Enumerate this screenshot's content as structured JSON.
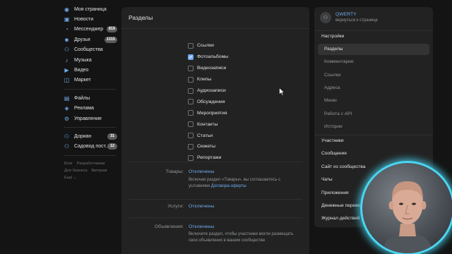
{
  "left_nav": {
    "items": [
      {
        "label": "Моя страница",
        "icon": "user-circle-icon",
        "glyph": "◉"
      },
      {
        "label": "Новости",
        "icon": "news-icon",
        "glyph": "▣"
      },
      {
        "label": "Мессенджер",
        "icon": "messenger-icon",
        "glyph": "◔",
        "badge": "819"
      },
      {
        "label": "Друзья",
        "icon": "friends-icon",
        "glyph": "☻",
        "badge": "1315"
      },
      {
        "label": "Сообщества",
        "icon": "communities-icon",
        "glyph": "⚇"
      },
      {
        "label": "Музыка",
        "icon": "music-icon",
        "glyph": "♪"
      },
      {
        "label": "Видео",
        "icon": "video-icon",
        "glyph": "▶"
      },
      {
        "label": "Маркет",
        "icon": "market-icon",
        "glyph": "◫"
      }
    ],
    "items2": [
      {
        "label": "Файлы",
        "icon": "files-icon",
        "glyph": "▤"
      },
      {
        "label": "Реклама",
        "icon": "ads-icon",
        "glyph": "◈"
      },
      {
        "label": "Управление",
        "icon": "manage-icon",
        "glyph": "⚙"
      }
    ],
    "items3": [
      {
        "label": "Дориан",
        "icon": "community-dorian-icon",
        "glyph": "⚇",
        "badge": "31"
      },
      {
        "label": "Садовод пост...",
        "icon": "community-gardener-icon",
        "glyph": "⚇",
        "badge": "12"
      }
    ],
    "footer": {
      "blog": "Блог",
      "developers": "Разработчикам",
      "business": "Для бизнеса",
      "authors": "Авторам",
      "more": "Ещё ⌄"
    }
  },
  "main": {
    "title": "Разделы",
    "sections": [
      {
        "label": "Ссылки",
        "checked": false
      },
      {
        "label": "Фотоальбомы",
        "checked": true
      },
      {
        "label": "Видеозаписи",
        "checked": false
      },
      {
        "label": "Клипы",
        "checked": false
      },
      {
        "label": "Аудиозаписи",
        "checked": false
      },
      {
        "label": "Обсуждения",
        "checked": false
      },
      {
        "label": "Мероприятия",
        "checked": false
      },
      {
        "label": "Контакты",
        "checked": false
      },
      {
        "label": "Статьи",
        "checked": false
      },
      {
        "label": "Сюжеты",
        "checked": false
      },
      {
        "label": "Репортажи",
        "checked": false
      }
    ],
    "goods": {
      "label": "Товары:",
      "value": "Отключены",
      "desc": "Включая раздел «Товары», вы соглашаетесь с условиями",
      "link": "Договора-оферты"
    },
    "services": {
      "label": "Услуги:",
      "value": "Отключены"
    },
    "ads": {
      "label": "Объявления:",
      "value": "Отключены",
      "desc": "Включите раздел, чтобы участники могли размещать свои объявления в вашем сообществе"
    }
  },
  "right": {
    "group_name": "QWERTY",
    "back_label": "вернуться к странице",
    "settings": "Настройки",
    "sub_items": [
      "Разделы",
      "Комментарии",
      "Ссылки",
      "Адреса",
      "Меню",
      "Работа с API",
      "Истории"
    ],
    "items": [
      "Участники",
      "Сообщения",
      "Сайт из сообщества",
      "Чаты",
      "Приложения",
      "Денежные перево...",
      "Журнал действий"
    ]
  },
  "colors": {
    "accent": "#71aaeb",
    "background": "#141414",
    "panel": "#222222",
    "webcam_ring": "#4ad6f2"
  }
}
